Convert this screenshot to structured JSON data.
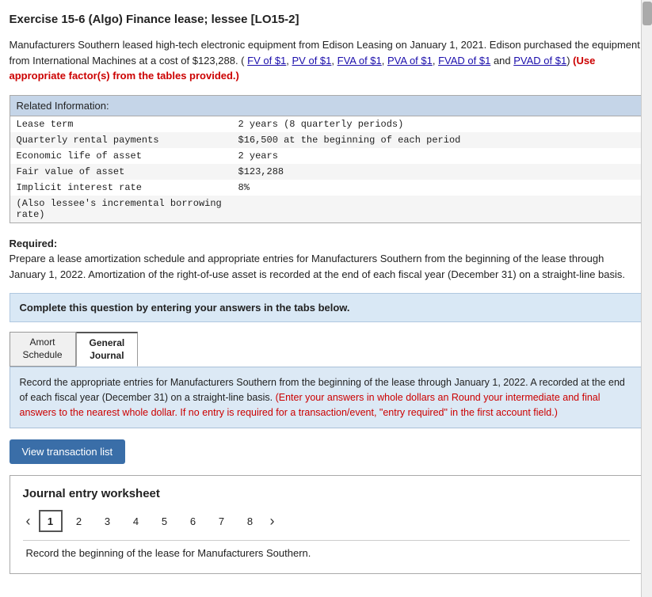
{
  "title": "Exercise 15-6 (Algo) Finance lease; lessee [LO15-2]",
  "intro": {
    "text1": "Manufacturers Southern leased high-tech electronic equipment from Edison Leasing on January 1, 2021. Edison purchased the equipment from International Machines at a cost of $123,288. (",
    "links": [
      {
        "label": "FV of $1",
        "href": "#"
      },
      {
        "label": "PV of $1",
        "href": "#"
      },
      {
        "label": "FVA of $1",
        "href": "#"
      },
      {
        "label": "PVA of $1",
        "href": "#"
      },
      {
        "label": "FVAD of $1",
        "href": "#"
      },
      {
        "label": "PVAD of $1",
        "href": "#"
      }
    ],
    "bold_red": "(Use appropriate factor(s) from the tables provided.)"
  },
  "related_info": {
    "header": "Related Information:",
    "rows": [
      {
        "label": "Lease term",
        "value": "2 years (8 quarterly periods)"
      },
      {
        "label": "Quarterly rental payments",
        "value": "$16,500 at the beginning of each period"
      },
      {
        "label": "Economic life of asset",
        "value": "2 years"
      },
      {
        "label": "Fair value of asset",
        "value": "$123,288"
      },
      {
        "label": "Implicit interest rate",
        "value": "8%"
      },
      {
        "label": "(Also lessee's incremental borrowing rate)",
        "value": ""
      }
    ]
  },
  "required": {
    "label": "Required:",
    "text": "Prepare a lease amortization schedule and appropriate entries for Manufacturers Southern from the beginning of the lease through January 1, 2022. Amortization of the right-of-use asset is recorded at the end of each fiscal year (December 31) on a straight-line basis."
  },
  "complete_box": "Complete this question by entering your answers in the tabs below.",
  "tabs": [
    {
      "label": "Amort\nSchedule",
      "active": false
    },
    {
      "label": "General\nJournal",
      "active": true
    }
  ],
  "instruction": {
    "text1": "Record the appropriate entries for Manufacturers Southern from the beginning of the lease through January 1, 2022. A recorded at the end of each fiscal year (December 31) on a straight-line basis. ",
    "red_text": "(Enter your answers in whole dollars an Round your intermediate and final answers to the nearest whole dollar. If no entry is required for a transaction/event, “ entry required” in the first account field.)"
  },
  "view_btn": "View transaction list",
  "worksheet": {
    "title": "Journal entry worksheet",
    "pages": [
      "1",
      "2",
      "3",
      "4",
      "5",
      "6",
      "7",
      "8"
    ],
    "active_page": "1",
    "record_text": "Record the beginning of the lease for Manufacturers Southern."
  }
}
